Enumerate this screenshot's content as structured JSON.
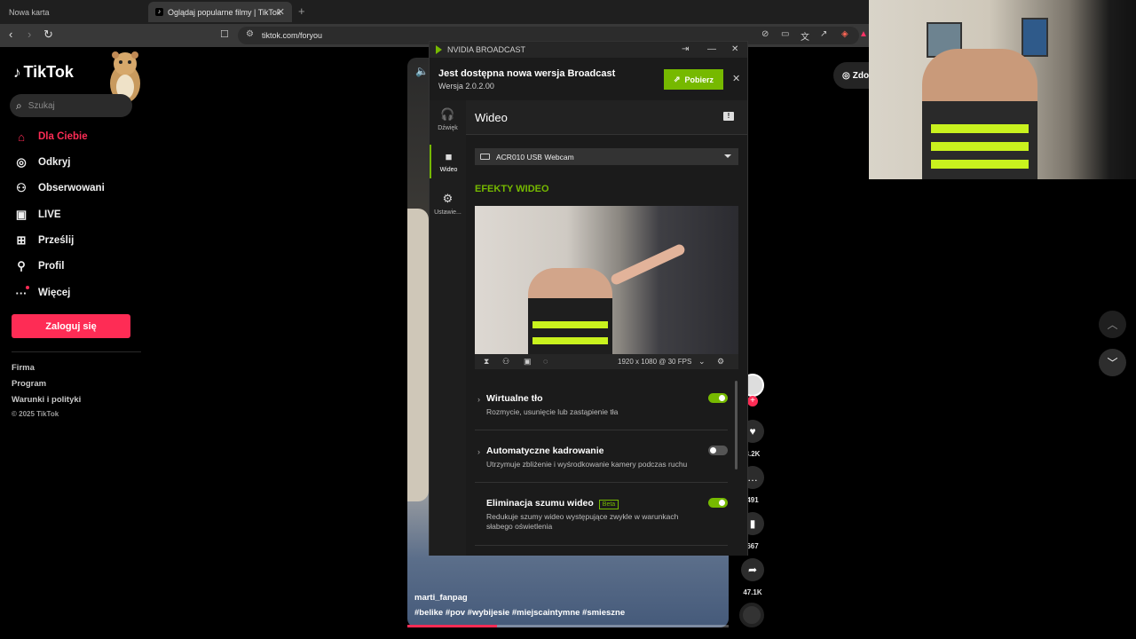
{
  "browser": {
    "tabs": [
      {
        "label": "Nowa karta",
        "active": false
      },
      {
        "label": "Oglądaj popularne filmy | TikTok",
        "active": true
      }
    ],
    "url": "tiktok.com/foryou"
  },
  "tiktok": {
    "logo_text": "TikTok",
    "search_placeholder": "Szukaj",
    "nav": [
      {
        "label": "Dla Ciebie",
        "icon": "home-icon",
        "active": true
      },
      {
        "label": "Odkryj",
        "icon": "compass-icon",
        "active": false
      },
      {
        "label": "Obserwowani",
        "icon": "following-icon",
        "active": false
      },
      {
        "label": "LIVE",
        "icon": "live-icon",
        "active": false
      },
      {
        "label": "Prześlij",
        "icon": "upload-icon",
        "active": false
      },
      {
        "label": "Profil",
        "icon": "profile-icon",
        "active": false
      },
      {
        "label": "Więcej",
        "icon": "more-icon",
        "active": false
      }
    ],
    "login_label": "Zaloguj się",
    "footer_links": [
      "Firma",
      "Program",
      "Warunki i polityki"
    ],
    "copyright": "© 2025 TikTok",
    "brand_color": "#fe2c55"
  },
  "video": {
    "author": "marti_fanpag",
    "tags": "#belike #pov #wybijesie #miejscaintymne #smieszne",
    "progress": 0.28,
    "counts": {
      "likes": "3.2K",
      "comments": "491",
      "saves": "667",
      "shares": "47.1K"
    },
    "side_button_label": "Zdo"
  },
  "broadcast": {
    "title": "NVIDIA BROADCAST",
    "update_title": "Jest dostępna nowa wersja Broadcast",
    "update_version": "Wersja 2.0.2.00",
    "download_label": "Pobierz",
    "sidebar": [
      {
        "label": "Dźwięk",
        "icon": "headset-icon"
      },
      {
        "label": "Wideo",
        "icon": "camera-icon",
        "active": true
      },
      {
        "label": "Ustawie...",
        "icon": "gear-icon"
      }
    ],
    "section_title": "Wideo",
    "device": "ACR010 USB Webcam",
    "effects_heading": "EFEKTY WIDEO",
    "resolution": "1920 x 1080 @ 30 FPS",
    "effects": [
      {
        "name": "Wirtualne tło",
        "desc": "Rozmycie, usunięcie lub zastąpienie tła",
        "enabled": true,
        "beta": false
      },
      {
        "name": "Automatyczne kadrowanie",
        "desc": "Utrzymuje zbliżenie i wyśrodkowanie kamery podczas ruchu",
        "enabled": false,
        "beta": false
      },
      {
        "name": "Eliminacja szumu wideo",
        "desc": "Redukuje szumy wideo występujące zwykle w warunkach słabego oświetlenia",
        "enabled": true,
        "beta": true,
        "beta_label": "Beta"
      }
    ],
    "accent_color": "#76b900"
  }
}
